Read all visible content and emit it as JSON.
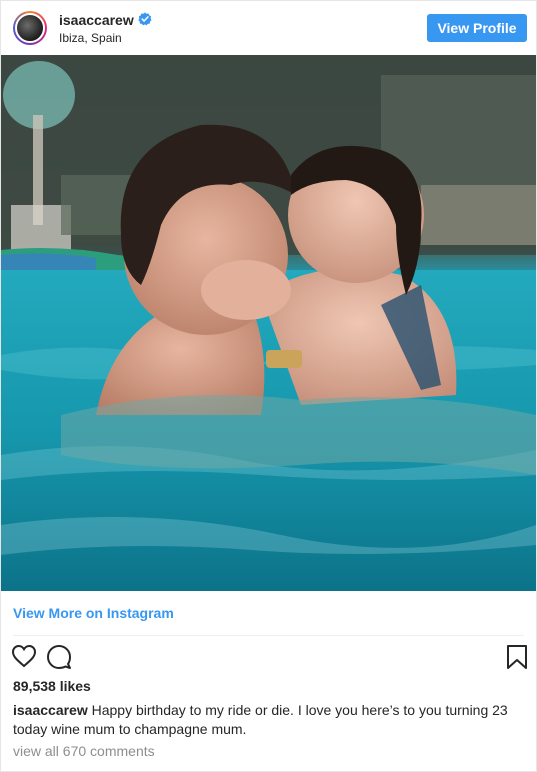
{
  "header": {
    "username": "isaaccarew",
    "location": "Ibiza, Spain",
    "view_profile_label": "View Profile"
  },
  "post": {
    "view_more_label": "View More on Instagram",
    "likes": "89,538 likes",
    "caption_user": "isaaccarew",
    "caption_text": "Happy birthday to my ride or die. I love you here’s to you turning 23 today wine mum to champagne mum.",
    "comments_label": "view all 670 comments"
  },
  "icons": {
    "verified": "verified-badge-icon",
    "like": "heart-icon",
    "comment": "comment-bubble-icon",
    "save": "bookmark-icon"
  },
  "colors": {
    "accent": "#3897f0",
    "text": "#262626",
    "muted": "#8e8e8e"
  }
}
